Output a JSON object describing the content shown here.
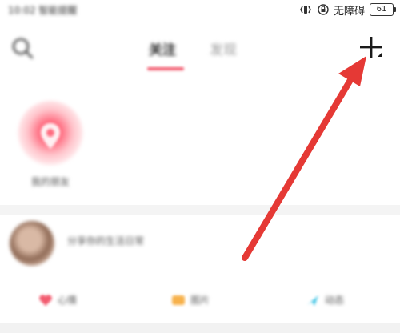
{
  "status_bar": {
    "time_carrier": "10:02 智能提醒",
    "accessibility": "无障碍",
    "battery": "61"
  },
  "header": {
    "tabs": [
      {
        "label": "关注"
      },
      {
        "label": "发现"
      }
    ]
  },
  "story": {
    "label": "我的朋友"
  },
  "feed": {
    "text": "分享你的生活日常"
  },
  "actions": [
    {
      "label": "心情"
    },
    {
      "label": "图片"
    },
    {
      "label": "动态"
    }
  ],
  "colors": {
    "accent": "#f25a6e",
    "arrow": "#e53935",
    "action1": "#f25a6e",
    "action2": "#f7b14b",
    "action3": "#48c7e6"
  }
}
